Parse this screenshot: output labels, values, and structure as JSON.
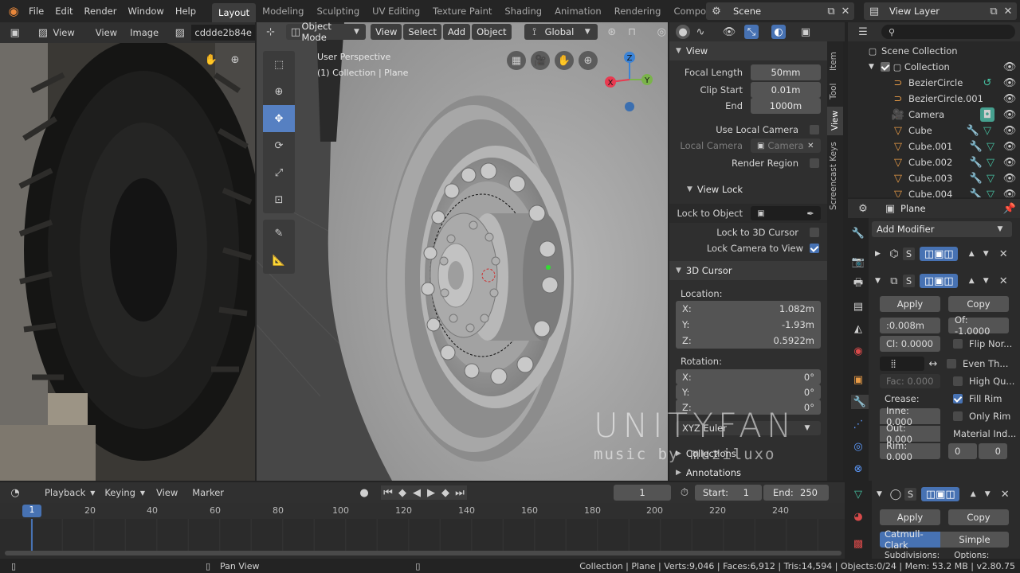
{
  "menu": {
    "file": "File",
    "edit": "Edit",
    "render": "Render",
    "window": "Window",
    "help": "Help"
  },
  "workspaces": [
    "Layout",
    "Modeling",
    "Sculpting",
    "UV Editing",
    "Texture Paint",
    "Shading",
    "Animation",
    "Rendering",
    "Compositing"
  ],
  "scene_name": "Scene",
  "view_layer": "View Layer",
  "image_editor": {
    "view1": "View",
    "view2": "View",
    "image": "Image",
    "image_name": "cddde2b84e"
  },
  "viewport": {
    "mode": "Object Mode",
    "menu_view": "View",
    "menu_select": "Select",
    "menu_add": "Add",
    "menu_object": "Object",
    "orientation": "Global",
    "info_line1": "User Perspective",
    "info_line2": "(1) Collection | Plane"
  },
  "axes": {
    "x": "X",
    "y": "Y",
    "z": "Z"
  },
  "npanel": {
    "tabs": [
      "Item",
      "Tool",
      "View",
      "Screencast Keys"
    ],
    "view_header": "View",
    "focal_label": "Focal Length",
    "focal_value": "50mm",
    "clip_start_label": "Clip Start",
    "clip_start_value": "0.01m",
    "clip_end_label": "End",
    "clip_end_value": "1000m",
    "use_local_camera": "Use Local Camera",
    "local_camera_label": "Local Camera",
    "local_camera_value": "Camera",
    "render_region": "Render Region",
    "view_lock_header": "View Lock",
    "lock_to_object": "Lock to Object",
    "lock_to_cursor": "Lock to 3D Cursor",
    "lock_camera": "Lock Camera to View",
    "cursor_header": "3D Cursor",
    "location_label": "Location:",
    "loc_x_label": "X:",
    "loc_x": "1.082m",
    "loc_y_label": "Y:",
    "loc_y": "-1.93m",
    "loc_z_label": "Z:",
    "loc_z": "0.5922m",
    "rotation_label": "Rotation:",
    "rot_x_label": "X:",
    "rot_x": "0°",
    "rot_y_label": "Y:",
    "rot_y": "0°",
    "rot_z_label": "Z:",
    "rot_z": "0°",
    "rotation_mode": "XYZ Euler",
    "collections": "Collections",
    "annotations": "Annotations"
  },
  "watermark": {
    "line1": "UNITYFAN",
    "line2": "music by muziluxo"
  },
  "outliner": {
    "root": "Scene Collection",
    "collection": "Collection",
    "items": [
      "BezierCircle",
      "BezierCircle.001",
      "Camera",
      "Cube",
      "Cube.001",
      "Cube.002",
      "Cube.003",
      "Cube.004"
    ]
  },
  "properties": {
    "object_name": "Plane",
    "add_modifier": "Add Modifier",
    "mod1_s": "S",
    "mod2_s": "S",
    "apply": "Apply",
    "copy": "Copy",
    "thickness": ":0.008m",
    "offset": "Of: -1.0000",
    "clamp": "Cl: 0.0000",
    "flip_normals": "Flip Nor...",
    "even_thickness": "Even Th...",
    "high_quality": "High Qu...",
    "fill_rim": "Fill Rim",
    "only_rim": "Only Rim",
    "factor": "Fac: 0.000",
    "crease_label": "Crease:",
    "inner": "Inne: 0.000",
    "outer": "Out: 0.000",
    "rim": "Rim: 0.000",
    "material_index": "Material Ind...",
    "mat_a": "0",
    "mat_b": "0",
    "mod3_s": "S",
    "apply2": "Apply",
    "copy2": "Copy",
    "catmull": "Catmull-Clark",
    "simple": "Simple",
    "subdivisions": "Subdivisions:",
    "options": "Options:"
  },
  "timeline": {
    "playback": "Playback",
    "keying": "Keying",
    "view": "View",
    "marker": "Marker",
    "current_frame": "1",
    "start_label": "Start:",
    "start": "1",
    "end_label": "End:",
    "end": "250",
    "ruler": [
      "1",
      "20",
      "40",
      "60",
      "80",
      "100",
      "120",
      "140",
      "160",
      "180",
      "200",
      "220",
      "240"
    ]
  },
  "statusbar": {
    "pan": "Pan View",
    "stats": "Collection | Plane | Verts:9,046 | Faces:6,912 | Tris:14,594 | Objects:0/24 | Mem: 53.2 MB | v2.80.75"
  },
  "colors": {
    "accent": "#4772b3",
    "selection_blue": "#5680c2",
    "x_axis": "#e83a50",
    "y_axis": "#7ab34a",
    "z_axis": "#3b83d6"
  }
}
